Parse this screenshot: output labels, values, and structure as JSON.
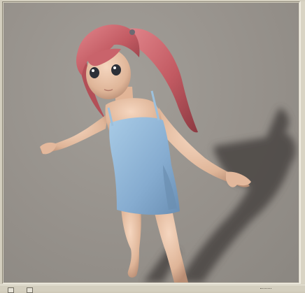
{
  "viewport": {
    "scene": "3d-render-girl-figure",
    "background_color": "#948f89",
    "hair_color": "#c8646b",
    "dress_color": "#8fb4d4",
    "skin_color": "#e8c1a6",
    "shadow_color": "#3f3b39"
  },
  "status_bar": {
    "buttons": [
      {
        "icon": "view-icon"
      },
      {
        "icon": "render-icon"
      }
    ]
  }
}
